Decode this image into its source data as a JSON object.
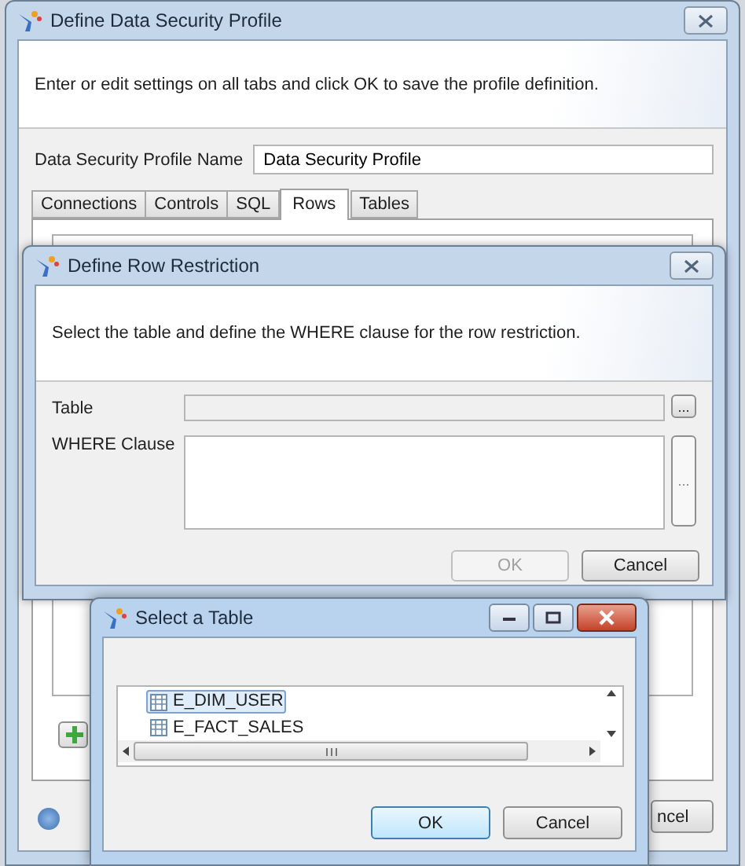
{
  "main_window": {
    "title": "Define Data Security Profile",
    "instruction": "Enter or edit settings on all tabs and click OK to save the profile definition.",
    "name_field": {
      "label": "Data Security Profile Name",
      "value": "Data Security Profile"
    },
    "tabs": [
      {
        "label": "Connections",
        "selected": false
      },
      {
        "label": "Controls",
        "selected": false
      },
      {
        "label": "SQL",
        "selected": false
      },
      {
        "label": "Rows",
        "selected": true
      },
      {
        "label": "Tables",
        "selected": false
      }
    ],
    "cancel_button": "ncel"
  },
  "row_dialog": {
    "title": "Define Row Restriction",
    "instruction": "Select the table and define the WHERE clause for the row restriction.",
    "table_field": {
      "label": "Table",
      "disabled": true
    },
    "table_browse": "...",
    "where_field": {
      "label": "WHERE Clause"
    },
    "where_browse": "...",
    "buttons": [
      {
        "label": "OK",
        "disabled": true
      },
      {
        "label": "Cancel",
        "disabled": false
      }
    ]
  },
  "table_dialog": {
    "title": "Select a Table",
    "tables": [
      {
        "name": "E_DIM_USER",
        "selected": true
      },
      {
        "name": "E_FACT_SALES",
        "selected": false
      }
    ],
    "buttons": [
      {
        "label": "OK",
        "default": true
      },
      {
        "label": "Cancel",
        "default": false
      }
    ]
  }
}
